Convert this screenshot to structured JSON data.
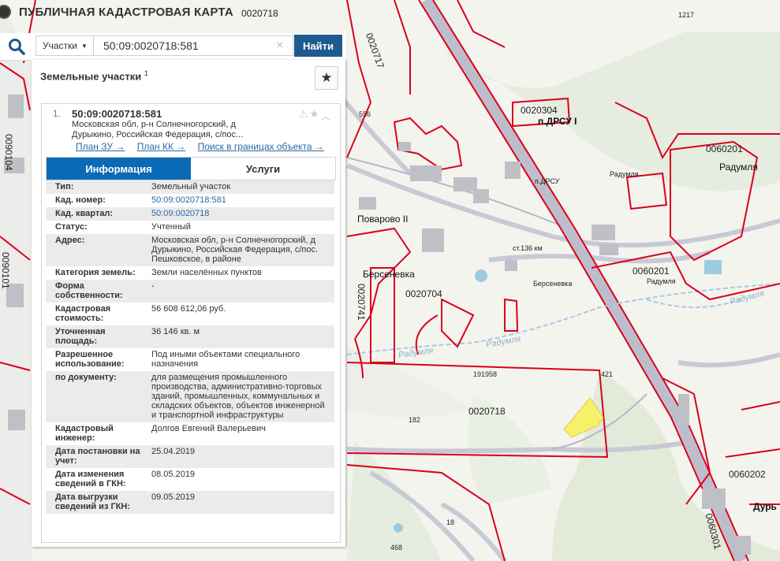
{
  "header": {
    "title": "ПУБЛИЧНАЯ КАДАСТРОВАЯ КАРТА"
  },
  "search": {
    "type_label": "Участки",
    "query": "50:09:0020718:581",
    "clear_icon": "×",
    "find_label": "Найти"
  },
  "panel": {
    "title": "Земельные участки",
    "count": "1",
    "favorites_icon": "★"
  },
  "result": {
    "index": "1.",
    "number": "50:09:0020718:581",
    "address_short": "Московская обл, р-н Солнечногорский, д Дурыкино, Российская Федерация, с/пос...",
    "actions": {
      "warning_icon": "⚠",
      "star_icon": "★",
      "collapse_icon": "︿"
    },
    "links": [
      "План ЗУ →",
      "План КК →",
      "Поиск в границах объекта →"
    ],
    "tabs": {
      "info": "Информация",
      "services": "Услуги"
    },
    "fields": [
      {
        "label": "Тип:",
        "value": "Земельный участок"
      },
      {
        "label": "Кад. номер:",
        "value": "50:09:0020718:581"
      },
      {
        "label": "Кад. квартал:",
        "value": "50:09:0020718"
      },
      {
        "label": "Статус:",
        "value": "Учтенный"
      },
      {
        "label": "Адрес:",
        "value": "Московская обл, р-н Солнечногорский, д Дурыкино, Российская Федерация, с/пос. Пешковское, в районе"
      },
      {
        "label": "Категория земель:",
        "value": "Земли населённых пунктов"
      },
      {
        "label": "Форма собственности:",
        "value": "-"
      },
      {
        "label": "Кадастровая стоимость:",
        "value": "56 608 612,06 руб."
      },
      {
        "label": "Уточненная площадь:",
        "value": "36 146 кв. м"
      },
      {
        "label": "Разрешенное использование:",
        "value": "Под иными объектами специального назначения"
      },
      {
        "label": "по документу:",
        "value": "для размещения промышленного производства, административно-торговых зданий, промышленных, коммунальных и складских объектов, объектов инженерной и транспортной инфраструктуры"
      },
      {
        "label": "Кадастровый инженер:",
        "value": "Долгов Евгений Валерьевич"
      },
      {
        "label": "Дата постановки на учет:",
        "value": "25.04.2019"
      },
      {
        "label": "Дата изменения сведений в ГКН:",
        "value": "08.05.2019"
      },
      {
        "label": "Дата выгрузки сведений из ГКН:",
        "value": "09.05.2019"
      }
    ]
  },
  "map": {
    "labels": [
      "0020718",
      "0020717",
      "1217",
      "556",
      "0020304",
      "п.ДРСУ I",
      "0060201",
      "Радумля",
      "п.ДРСУ",
      "Радумля",
      "Поварово II",
      "0020704",
      "Берсеневка",
      "ст.136 км",
      "Берсеневка",
      "0060201",
      "Радумля",
      "Радумля",
      "0020741",
      "Радумля",
      "Радумля",
      "191958",
      "421",
      "0020718",
      "182",
      "0060202",
      "Дурь",
      "0060301",
      "18",
      "468",
      "0090104",
      "0090101"
    ],
    "colors": {
      "boundary": "#d9001b",
      "road": "#c9c9d6",
      "selected_parcel": "#f7f06a",
      "river": "#a9c9e0"
    }
  }
}
